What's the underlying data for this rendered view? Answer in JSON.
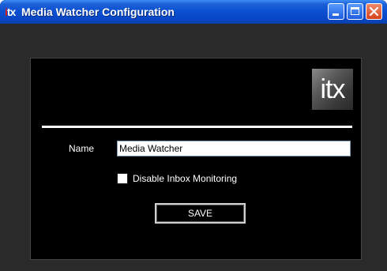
{
  "window": {
    "title": "Media Watcher Configuration",
    "app_icon_text": "itx",
    "controls": {
      "minimize": "minimize-icon",
      "maximize": "maximize-icon",
      "close": "close-icon"
    }
  },
  "form": {
    "logo_text": "itx",
    "name_label": "Name",
    "name_value": "Media Watcher",
    "disable_inbox_label": "Disable Inbox Monitoring",
    "disable_inbox_checked": false,
    "save_label": "SAVE"
  },
  "colors": {
    "titlebar": "#0a4fd0",
    "panel_background": "#000000",
    "frame_background": "#2a2a2a",
    "close_button": "#d6431c"
  }
}
